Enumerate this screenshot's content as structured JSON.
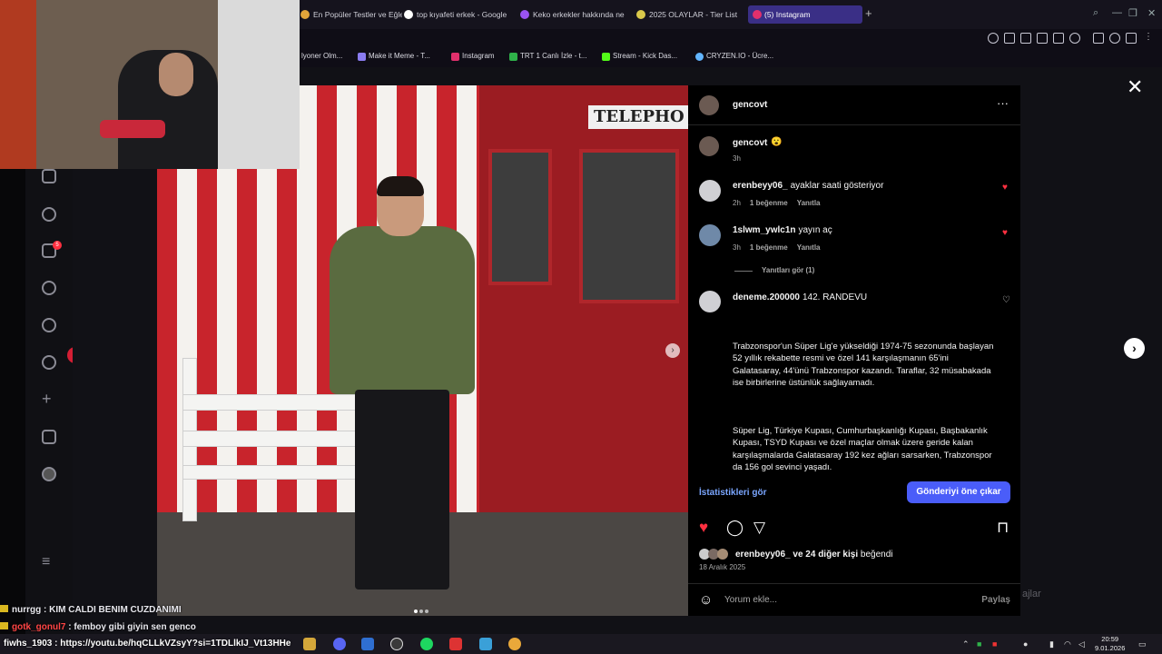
{
  "browser": {
    "tabs": [
      {
        "label": "En Popüler Testler ve Eğle",
        "color": "#e2a53a"
      },
      {
        "label": "top kıyafeti erkek - Google",
        "color": "#ffffff"
      },
      {
        "label": "Keko erkekler hakkında ne",
        "color": "#9a53f1"
      },
      {
        "label": "2025 OLAYLAR - Tier List",
        "color": "#d9c84a"
      },
      {
        "label": "(5) Instagram",
        "color": "#e1306c"
      }
    ],
    "new_tab": "+",
    "bookmarks": [
      {
        "label": "lyoner Olm...",
        "color": "#777777"
      },
      {
        "label": "Make it Meme - T...",
        "color": "#8a7cf0"
      },
      {
        "label": "Instagram",
        "color": "#e1306c"
      },
      {
        "label": "TRT 1 Canlı İzle - t...",
        "color": "#2fb14a"
      },
      {
        "label": "Stream - Kick Das...",
        "color": "#53fc18"
      },
      {
        "label": "CRYZEN.IO - Ücre...",
        "color": "#62b5ff"
      }
    ]
  },
  "ig_sidebar": {
    "notif_badge": "5",
    "like_pill": "1"
  },
  "post": {
    "author": "gencovt",
    "caption_emoji": "😮",
    "caption_time": "3h",
    "comments": [
      {
        "user": "erenbeyy06_",
        "text": "ayaklar saati gösteriyor",
        "time": "2h",
        "likes": "1 beğenme",
        "reply": "Yanıtla",
        "liked": true
      },
      {
        "user": "1slwm_ywlc1n",
        "text": "yayın aç",
        "time": "3h",
        "likes": "1 beğenme",
        "reply": "Yanıtla",
        "liked": true,
        "view_replies": "Yanıtları gör (1)"
      },
      {
        "user": "deneme.200000",
        "text": "142. RANDEVU",
        "liked": false
      }
    ],
    "long_text_1": "Trabzonspor'un Süper Lig'e yükseldiği 1974-75 sezonunda başlayan 52 yıllık rekabette resmi ve özel 141 karşılaşmanın 65'ini Galatasaray, 44'ünü Trabzonspor kazandı. Taraflar, 32 müsabakada ise birbirlerine üstünlük sağlayamadı.",
    "long_text_2": "Süper Lig, Türkiye Kupası, Cumhurbaşkanlığı Kupası, Başbakanlık Kupası, TSYD Kupası ve özel maçlar olmak üzere geride kalan karşılaşmalarda Galatasaray 192 kez ağları sarsarken, Trabzonspor da 156 gol sevinci yaşadı.",
    "stats_link": "İstatistikleri gör",
    "boost_button": "Gönderiyi öne çıkar",
    "liked_by_user": "erenbeyy06_",
    "liked_by_rest": "ve 24 diğer kişi",
    "liked_by_suffix": "beğendi",
    "date": "18 Aralık 2025",
    "comment_placeholder": "Yorum ekle...",
    "share_label": "Paylaş",
    "photo_sign": "TELEPHO",
    "accent": "#ff3040"
  },
  "background_text": "ajlar",
  "stream_chat": [
    {
      "user": "nurrgg",
      "msg": "KIM CALDI BENIM CUZDANIMI",
      "color": "#ffffff"
    },
    {
      "user": "gotk_gonul7",
      "msg": "femboy gibi giyin sen genco",
      "color": "#ff4545"
    }
  ],
  "url_overlay": "fiwhs_1903 : https://youtu.be/hqCLLkVZsyY?si=1TDLlkIJ_Vt13HHe",
  "taskbar": {
    "time": "20:59",
    "date": "9.01.2026"
  }
}
